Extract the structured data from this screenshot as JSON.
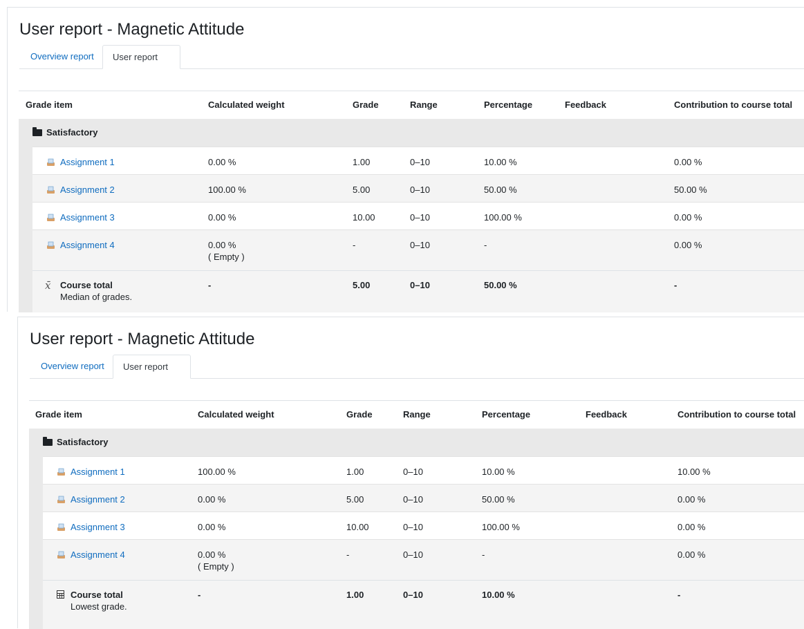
{
  "reports": [
    {
      "title": "User report - Magnetic Attitude",
      "tabs": [
        "Overview report",
        "User report"
      ],
      "active_tab": "User report",
      "headers": {
        "grade_item": "Grade item",
        "calculated_weight": "Calculated weight",
        "grade": "Grade",
        "range": "Range",
        "percentage": "Percentage",
        "feedback": "Feedback",
        "contribution": "Contribution to course total"
      },
      "category": "Satisfactory",
      "rows": [
        {
          "name": "Assignment 1",
          "weight": "0.00 %",
          "weight_note": "",
          "grade": "1.00",
          "range": "0–10",
          "percentage": "10.00 %",
          "feedback": "",
          "contribution": "0.00 %"
        },
        {
          "name": "Assignment 2",
          "weight": "100.00 %",
          "weight_note": "",
          "grade": "5.00",
          "range": "0–10",
          "percentage": "50.00 %",
          "feedback": "",
          "contribution": "50.00 %"
        },
        {
          "name": "Assignment 3",
          "weight": "0.00 %",
          "weight_note": "",
          "grade": "10.00",
          "range": "0–10",
          "percentage": "100.00 %",
          "feedback": "",
          "contribution": "0.00 %"
        },
        {
          "name": "Assignment 4",
          "weight": "0.00 %",
          "weight_note": "( Empty )",
          "grade": "-",
          "range": "0–10",
          "percentage": "-",
          "feedback": "",
          "contribution": "0.00 %"
        }
      ],
      "total": {
        "name": "Course total",
        "description": "Median of grades.",
        "icon": "x-bar-mean-icon",
        "weight": "-",
        "grade": "5.00",
        "range": "0–10",
        "percentage": "50.00 %",
        "contribution": "-"
      }
    },
    {
      "title": "User report - Magnetic Attitude",
      "tabs": [
        "Overview report",
        "User report"
      ],
      "active_tab": "User report",
      "headers": {
        "grade_item": "Grade item",
        "calculated_weight": "Calculated weight",
        "grade": "Grade",
        "range": "Range",
        "percentage": "Percentage",
        "feedback": "Feedback",
        "contribution": "Contribution to course total"
      },
      "category": "Satisfactory",
      "rows": [
        {
          "name": "Assignment 1",
          "weight": "100.00 %",
          "weight_note": "",
          "grade": "1.00",
          "range": "0–10",
          "percentage": "10.00 %",
          "feedback": "",
          "contribution": "10.00 %"
        },
        {
          "name": "Assignment 2",
          "weight": "0.00 %",
          "weight_note": "",
          "grade": "5.00",
          "range": "0–10",
          "percentage": "50.00 %",
          "feedback": "",
          "contribution": "0.00 %"
        },
        {
          "name": "Assignment 3",
          "weight": "0.00 %",
          "weight_note": "",
          "grade": "10.00",
          "range": "0–10",
          "percentage": "100.00 %",
          "feedback": "",
          "contribution": "0.00 %"
        },
        {
          "name": "Assignment 4",
          "weight": "0.00 %",
          "weight_note": "( Empty )",
          "grade": "-",
          "range": "0–10",
          "percentage": "-",
          "feedback": "",
          "contribution": "0.00 %"
        }
      ],
      "total": {
        "name": "Course total",
        "description": "Lowest grade.",
        "icon": "calculator-icon",
        "weight": "-",
        "grade": "1.00",
        "range": "0–10",
        "percentage": "10.00 %",
        "contribution": "-"
      }
    }
  ]
}
